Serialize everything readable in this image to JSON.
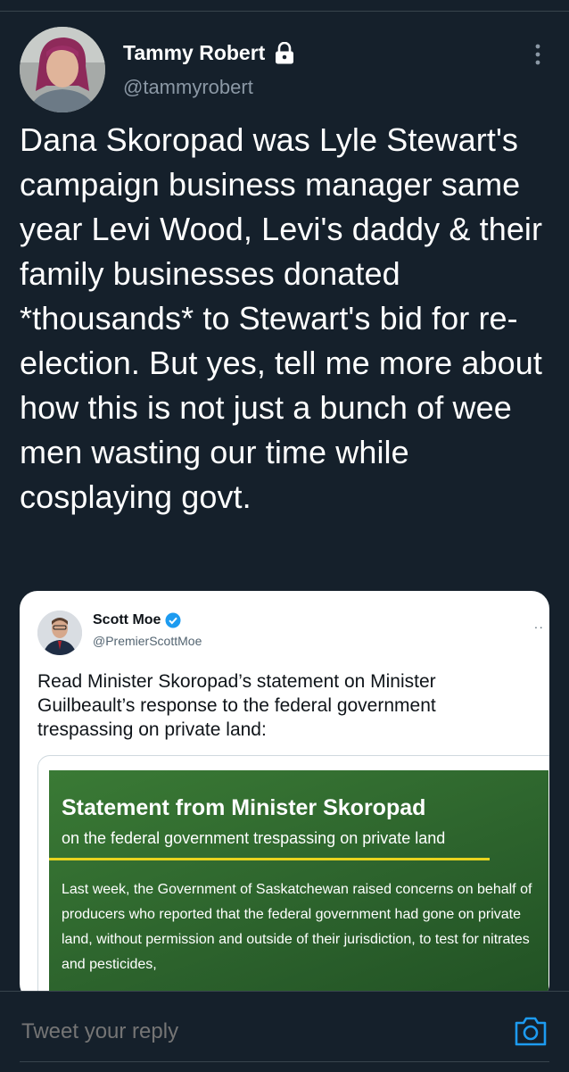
{
  "tweet": {
    "author_name": "Tammy Robert",
    "author_handle": "@tammyrobert",
    "text": "Dana Skoropad was Lyle Stewart's campaign business manager same year Levi Wood, Levi's daddy & their family businesses donated *thousands* to Stewart's bid for re-election. But yes, tell me more about how this is not just a bunch of wee men wasting our time while cosplaying govt."
  },
  "quoted_tweet": {
    "author_name": "Scott Moe",
    "author_handle": "@PremierScottMoe",
    "more_label": "··",
    "text": "Read Minister Skoropad’s statement on Minister Guilbeault’s response to the federal government trespassing on private land:",
    "media": {
      "title": "Statement from Minister Skoropad",
      "subtitle": "on the federal government trespassing on private land",
      "body": "Last week, the Government of Saskatchewan raised concerns on behalf of producers who reported that the federal government had gone on private land, without permission and outside of their jurisdiction, to test for nitrates and pesticides,"
    }
  },
  "reply": {
    "placeholder": "Tweet your reply"
  },
  "icons": {
    "lock": "lock-icon",
    "more": "more-vertical-icon",
    "verified": "verified-badge-icon",
    "camera": "camera-icon"
  },
  "colors": {
    "background": "#15202b",
    "accent": "#1d9bf0",
    "secondary_text": "#8b98a5",
    "media_green": "#2d6a2f",
    "media_rule": "#e8d41f"
  }
}
